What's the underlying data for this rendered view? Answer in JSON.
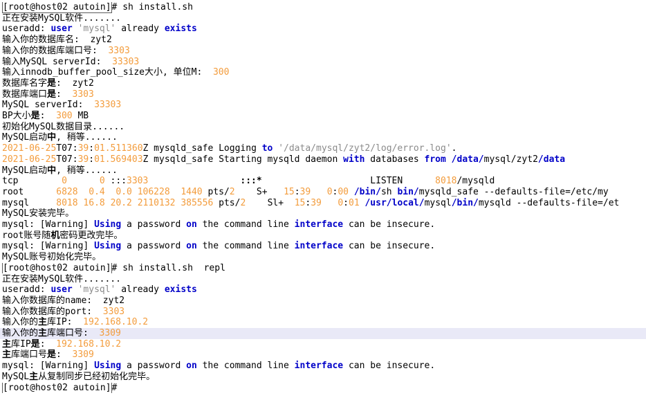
{
  "colors": {
    "background": "#ffffff",
    "text": "#000000",
    "keyword": "#0000c8",
    "number": "#f39c3c",
    "string": "#8a8a8a",
    "highlight": "#e9e9f7"
  },
  "lines": [
    {
      "segments": [
        {
          "t": "[root@host02 autoin]",
          "c": "prompt"
        },
        {
          "t": "# sh install.sh",
          "c": "plain"
        }
      ]
    },
    {
      "segments": [
        {
          "t": "正在安装MySQL软件.......",
          "c": "plain"
        }
      ]
    },
    {
      "segments": [
        {
          "t": "useradd: ",
          "c": "plain"
        },
        {
          "t": "user",
          "c": "kw"
        },
        {
          "t": " ",
          "c": "plain"
        },
        {
          "t": "'mysql'",
          "c": "str"
        },
        {
          "t": " already ",
          "c": "plain"
        },
        {
          "t": "exists",
          "c": "kw"
        }
      ]
    },
    {
      "segments": [
        {
          "t": "输入你的数据库名:  zyt2",
          "c": "plain"
        }
      ]
    },
    {
      "segments": [
        {
          "t": "输入你的数据库端口号:  ",
          "c": "plain"
        },
        {
          "t": "3303",
          "c": "num"
        }
      ]
    },
    {
      "segments": [
        {
          "t": "输入MySQL serverId:  ",
          "c": "plain"
        },
        {
          "t": "33303",
          "c": "num"
        }
      ]
    },
    {
      "segments": [
        {
          "t": "输入innodb_buffer_pool_size大小, 单位M:  ",
          "c": "plain"
        },
        {
          "t": "300",
          "c": "num"
        }
      ]
    },
    {
      "segments": [
        {
          "t": "数据库名字",
          "c": "plain"
        },
        {
          "t": "是",
          "c": "b"
        },
        {
          "t": ":  zyt2",
          "c": "plain"
        }
      ]
    },
    {
      "segments": [
        {
          "t": "数据库端口",
          "c": "plain"
        },
        {
          "t": "是",
          "c": "b"
        },
        {
          "t": ":  ",
          "c": "plain"
        },
        {
          "t": "3303",
          "c": "num"
        }
      ]
    },
    {
      "segments": [
        {
          "t": "MySQL serverId:  ",
          "c": "plain"
        },
        {
          "t": "33303",
          "c": "num"
        }
      ]
    },
    {
      "segments": [
        {
          "t": "BP大小",
          "c": "plain"
        },
        {
          "t": "是",
          "c": "b"
        },
        {
          "t": ":  ",
          "c": "plain"
        },
        {
          "t": "300",
          "c": "num"
        },
        {
          "t": " MB",
          "c": "plain"
        }
      ]
    },
    {
      "segments": [
        {
          "t": "初始化MySQL数据目录......",
          "c": "plain"
        }
      ]
    },
    {
      "segments": [
        {
          "t": "MySQL启动",
          "c": "plain"
        },
        {
          "t": "中",
          "c": "b"
        },
        {
          "t": ", 稍等......",
          "c": "plain"
        }
      ]
    },
    {
      "segments": [
        {
          "t": "2021-06-25",
          "c": "num"
        },
        {
          "t": "T07:",
          "c": "plain"
        },
        {
          "t": "39",
          "c": "num"
        },
        {
          "t": ":",
          "c": "plain"
        },
        {
          "t": "01.511360",
          "c": "num"
        },
        {
          "t": "Z mysqld_safe Logging ",
          "c": "plain"
        },
        {
          "t": "to",
          "c": "kw"
        },
        {
          "t": " ",
          "c": "plain"
        },
        {
          "t": "'/data/mysql/zyt2/log/error.log'",
          "c": "str"
        },
        {
          "t": ".",
          "c": "plain"
        }
      ]
    },
    {
      "segments": [
        {
          "t": "2021-06-25",
          "c": "num"
        },
        {
          "t": "T07:",
          "c": "plain"
        },
        {
          "t": "39",
          "c": "num"
        },
        {
          "t": ":",
          "c": "plain"
        },
        {
          "t": "01.569403",
          "c": "num"
        },
        {
          "t": "Z mysqld_safe Starting mysqld daemon ",
          "c": "plain"
        },
        {
          "t": "with",
          "c": "kw"
        },
        {
          "t": " databases ",
          "c": "plain"
        },
        {
          "t": "from",
          "c": "kw"
        },
        {
          "t": " ",
          "c": "plain"
        },
        {
          "t": "/data/",
          "c": "kw"
        },
        {
          "t": "mysql/zyt2",
          "c": "plain"
        },
        {
          "t": "/data",
          "c": "kw"
        }
      ]
    },
    {
      "segments": [
        {
          "t": "MySQL启动",
          "c": "plain"
        },
        {
          "t": "中",
          "c": "b"
        },
        {
          "t": ", 稍等......",
          "c": "plain"
        }
      ]
    },
    {
      "segments": [
        {
          "t": "tcp        ",
          "c": "plain"
        },
        {
          "t": "0",
          "c": "num"
        },
        {
          "t": "      ",
          "c": "plain"
        },
        {
          "t": "0",
          "c": "num"
        },
        {
          "t": " :::",
          "c": "plain"
        },
        {
          "t": "3303",
          "c": "num"
        },
        {
          "t": "                 ",
          "c": "plain"
        },
        {
          "t": ":::*",
          "c": "b"
        },
        {
          "t": "                    LISTEN      ",
          "c": "plain"
        },
        {
          "t": "8018",
          "c": "num"
        },
        {
          "t": "/mysqld",
          "c": "plain"
        }
      ]
    },
    {
      "segments": [
        {
          "t": "root      ",
          "c": "plain"
        },
        {
          "t": "6828",
          "c": "num"
        },
        {
          "t": "  ",
          "c": "plain"
        },
        {
          "t": "0.4",
          "c": "num"
        },
        {
          "t": "  ",
          "c": "plain"
        },
        {
          "t": "0.0",
          "c": "num"
        },
        {
          "t": " ",
          "c": "plain"
        },
        {
          "t": "106228",
          "c": "num"
        },
        {
          "t": "  ",
          "c": "plain"
        },
        {
          "t": "1440",
          "c": "num"
        },
        {
          "t": " pts/",
          "c": "plain"
        },
        {
          "t": "2",
          "c": "num"
        },
        {
          "t": "    S+   ",
          "c": "plain"
        },
        {
          "t": "15",
          "c": "num"
        },
        {
          "t": ":",
          "c": "plain"
        },
        {
          "t": "39",
          "c": "num"
        },
        {
          "t": "   ",
          "c": "plain"
        },
        {
          "t": "0",
          "c": "num"
        },
        {
          "t": ":",
          "c": "plain"
        },
        {
          "t": "00",
          "c": "num"
        },
        {
          "t": " ",
          "c": "plain"
        },
        {
          "t": "/bin/",
          "c": "kw"
        },
        {
          "t": "sh ",
          "c": "plain"
        },
        {
          "t": "bin/",
          "c": "kw"
        },
        {
          "t": "mysqld_safe --defaults-file=/etc/my",
          "c": "plain"
        }
      ]
    },
    {
      "segments": [
        {
          "t": "mysql     ",
          "c": "plain"
        },
        {
          "t": "8018",
          "c": "num"
        },
        {
          "t": " ",
          "c": "plain"
        },
        {
          "t": "16.8",
          "c": "num"
        },
        {
          "t": " ",
          "c": "plain"
        },
        {
          "t": "20.2",
          "c": "num"
        },
        {
          "t": " ",
          "c": "plain"
        },
        {
          "t": "2110132",
          "c": "num"
        },
        {
          "t": " ",
          "c": "plain"
        },
        {
          "t": "385556",
          "c": "num"
        },
        {
          "t": " pts/",
          "c": "plain"
        },
        {
          "t": "2",
          "c": "num"
        },
        {
          "t": "    Sl+  ",
          "c": "plain"
        },
        {
          "t": "15",
          "c": "num"
        },
        {
          "t": ":",
          "c": "plain"
        },
        {
          "t": "39",
          "c": "num"
        },
        {
          "t": "   ",
          "c": "plain"
        },
        {
          "t": "0",
          "c": "num"
        },
        {
          "t": ":",
          "c": "plain"
        },
        {
          "t": "01",
          "c": "num"
        },
        {
          "t": " ",
          "c": "plain"
        },
        {
          "t": "/usr/local/",
          "c": "kw"
        },
        {
          "t": "mysql",
          "c": "plain"
        },
        {
          "t": "/bin/",
          "c": "kw"
        },
        {
          "t": "mysqld --defaults-file=/et",
          "c": "plain"
        }
      ]
    },
    {
      "segments": [
        {
          "t": "MySQL安装完毕。",
          "c": "plain"
        }
      ]
    },
    {
      "segments": [
        {
          "t": "mysql: [Warning] ",
          "c": "plain"
        },
        {
          "t": "Using",
          "c": "kw"
        },
        {
          "t": " a password ",
          "c": "plain"
        },
        {
          "t": "on",
          "c": "kw"
        },
        {
          "t": " the command line ",
          "c": "plain"
        },
        {
          "t": "interface",
          "c": "kw"
        },
        {
          "t": " can be insecure.",
          "c": "plain"
        }
      ]
    },
    {
      "segments": [
        {
          "t": "root账号随",
          "c": "plain"
        },
        {
          "t": "机",
          "c": "b"
        },
        {
          "t": "密码更改完毕。",
          "c": "plain"
        }
      ]
    },
    {
      "segments": [
        {
          "t": "mysql: [Warning] ",
          "c": "plain"
        },
        {
          "t": "Using",
          "c": "kw"
        },
        {
          "t": " a password ",
          "c": "plain"
        },
        {
          "t": "on",
          "c": "kw"
        },
        {
          "t": " the command line ",
          "c": "plain"
        },
        {
          "t": "interface",
          "c": "kw"
        },
        {
          "t": " can be insecure.",
          "c": "plain"
        }
      ]
    },
    {
      "segments": [
        {
          "t": "MySQL账号初始化完毕。",
          "c": "plain"
        }
      ]
    },
    {
      "segments": [
        {
          "t": "[root@host02 autoin]",
          "c": "prompt"
        },
        {
          "t": "# sh install.sh  repl",
          "c": "plain"
        }
      ]
    },
    {
      "segments": [
        {
          "t": "正在安装MySQL软件.......",
          "c": "plain"
        }
      ]
    },
    {
      "segments": [
        {
          "t": "useradd: ",
          "c": "plain"
        },
        {
          "t": "user",
          "c": "kw"
        },
        {
          "t": " ",
          "c": "plain"
        },
        {
          "t": "'mysql'",
          "c": "str"
        },
        {
          "t": " already ",
          "c": "plain"
        },
        {
          "t": "exists",
          "c": "kw"
        }
      ]
    },
    {
      "segments": [
        {
          "t": "输入你数据库的name:  zyt2",
          "c": "plain"
        }
      ]
    },
    {
      "segments": [
        {
          "t": "输入你数据库的port:  ",
          "c": "plain"
        },
        {
          "t": "3303",
          "c": "num"
        }
      ]
    },
    {
      "segments": [
        {
          "t": "输入你的",
          "c": "plain"
        },
        {
          "t": "主",
          "c": "b"
        },
        {
          "t": "库IP:  ",
          "c": "plain"
        },
        {
          "t": "192.168.10.2",
          "c": "num"
        }
      ]
    },
    {
      "segments": [
        {
          "t": "输入你的",
          "c": "plain"
        },
        {
          "t": "主",
          "c": "b"
        },
        {
          "t": "库端口号:  ",
          "c": "plain"
        },
        {
          "t": "3309",
          "c": "num"
        }
      ],
      "highlight": true
    },
    {
      "segments": [
        {
          "t": "主",
          "c": "b"
        },
        {
          "t": "库IP",
          "c": "plain"
        },
        {
          "t": "是",
          "c": "b"
        },
        {
          "t": ":  ",
          "c": "plain"
        },
        {
          "t": "192.168.10.2",
          "c": "num"
        }
      ]
    },
    {
      "segments": [
        {
          "t": "主",
          "c": "b"
        },
        {
          "t": "库端口号",
          "c": "plain"
        },
        {
          "t": "是",
          "c": "b"
        },
        {
          "t": ":  ",
          "c": "plain"
        },
        {
          "t": "3309",
          "c": "num"
        }
      ]
    },
    {
      "segments": [
        {
          "t": "mysql: [Warning] ",
          "c": "plain"
        },
        {
          "t": "Using",
          "c": "kw"
        },
        {
          "t": " a password ",
          "c": "plain"
        },
        {
          "t": "on",
          "c": "kw"
        },
        {
          "t": " the command line ",
          "c": "plain"
        },
        {
          "t": "interface",
          "c": "kw"
        },
        {
          "t": " can be insecure.",
          "c": "plain"
        }
      ]
    },
    {
      "segments": [
        {
          "t": "MySQL",
          "c": "plain"
        },
        {
          "t": "主",
          "c": "b"
        },
        {
          "t": "从复制同步已经初始化完毕。",
          "c": "plain"
        }
      ]
    },
    {
      "segments": [
        {
          "t": "[root@host02 autoin]",
          "c": "prompt"
        },
        {
          "t": "#",
          "c": "plain"
        }
      ]
    }
  ]
}
